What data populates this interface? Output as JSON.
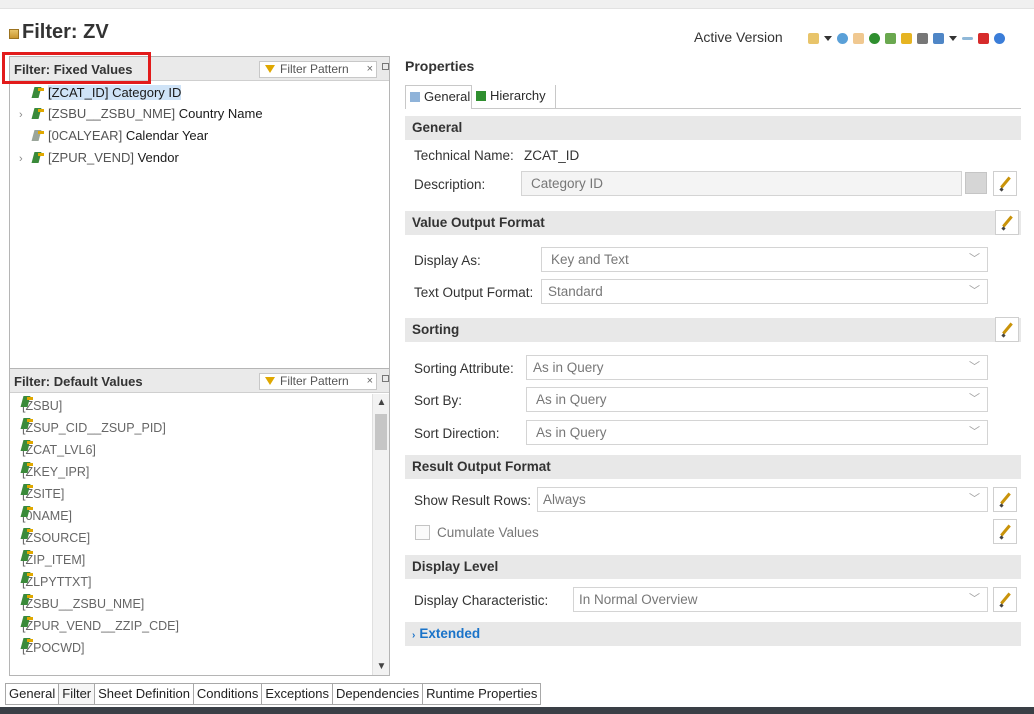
{
  "window": {
    "title": "Filter: ZV",
    "active_version": "Active Version"
  },
  "fixed_values": {
    "title": "Filter: Fixed Values",
    "filter_placeholder": "Filter Pattern",
    "items": [
      {
        "key": "[ZCAT_ID]",
        "text": "Category ID",
        "expandable": false,
        "selected": true
      },
      {
        "key": "[ZSBU__ZSBU_NME]",
        "text": "Country Name",
        "expandable": true,
        "selected": false
      },
      {
        "key": "[0CALYEAR]",
        "text": "Calendar Year",
        "expandable": false,
        "selected": false
      },
      {
        "key": "[ZPUR_VEND]",
        "text": "Vendor",
        "expandable": true,
        "selected": false
      }
    ]
  },
  "default_values": {
    "title": "Filter: Default Values",
    "filter_placeholder": "Filter Pattern",
    "items": [
      "[ZSBU]",
      "[ZSUP_CID__ZSUP_PID]",
      "[ZCAT_LVL6]",
      "[ZKEY_IPR]",
      "[ZSITE]",
      "[0NAME]",
      "[ZSOURCE]",
      "[ZIP_ITEM]",
      "[ZLPYTTXT]",
      "[ZSBU__ZSBU_NME]",
      "[ZPUR_VEND__ZZIP_CDE]",
      "[ZPOCWD]"
    ]
  },
  "properties": {
    "title": "Properties",
    "tabs": [
      "General",
      "Hierarchy"
    ],
    "general": {
      "header": "General",
      "technical_name_label": "Technical Name:",
      "technical_name_value": "ZCAT_ID",
      "description_label": "Description:",
      "description_value": "Category ID"
    },
    "value_output": {
      "header": "Value Output Format",
      "display_as_label": "Display As:",
      "display_as_value": "Key and Text",
      "text_output_label": "Text Output Format:",
      "text_output_value": "Standard"
    },
    "sorting": {
      "header": "Sorting",
      "attribute_label": "Sorting Attribute:",
      "attribute_value": "As in Query",
      "sort_by_label": "Sort By:",
      "sort_by_value": "As in Query",
      "direction_label": "Sort Direction:",
      "direction_value": "As in Query"
    },
    "result_output": {
      "header": "Result Output Format",
      "show_rows_label": "Show Result Rows:",
      "show_rows_value": "Always",
      "cumulate_label": "Cumulate Values"
    },
    "display_level": {
      "header": "Display Level",
      "characteristic_label": "Display Characteristic:",
      "characteristic_value": "In Normal Overview"
    },
    "extended": {
      "header": "Extended"
    }
  },
  "bottom_tabs": [
    "General",
    "Filter",
    "Sheet Definition",
    "Conditions",
    "Exceptions",
    "Dependencies",
    "Runtime Properties"
  ],
  "icons": {
    "toolbar": [
      "activate-icon",
      "dropdown-arrow-icon",
      "refresh-icon",
      "document-icon",
      "globe-icon",
      "tools-icon",
      "database-icon",
      "hierarchy-icon",
      "link-icon",
      "dropdown-arrow-icon",
      "minimize-icon",
      "close-icon",
      "help-icon"
    ]
  },
  "colors": {
    "highlight": "#e21b1b",
    "selection": "#cfe3f7",
    "extended_link": "#1a73c9"
  }
}
